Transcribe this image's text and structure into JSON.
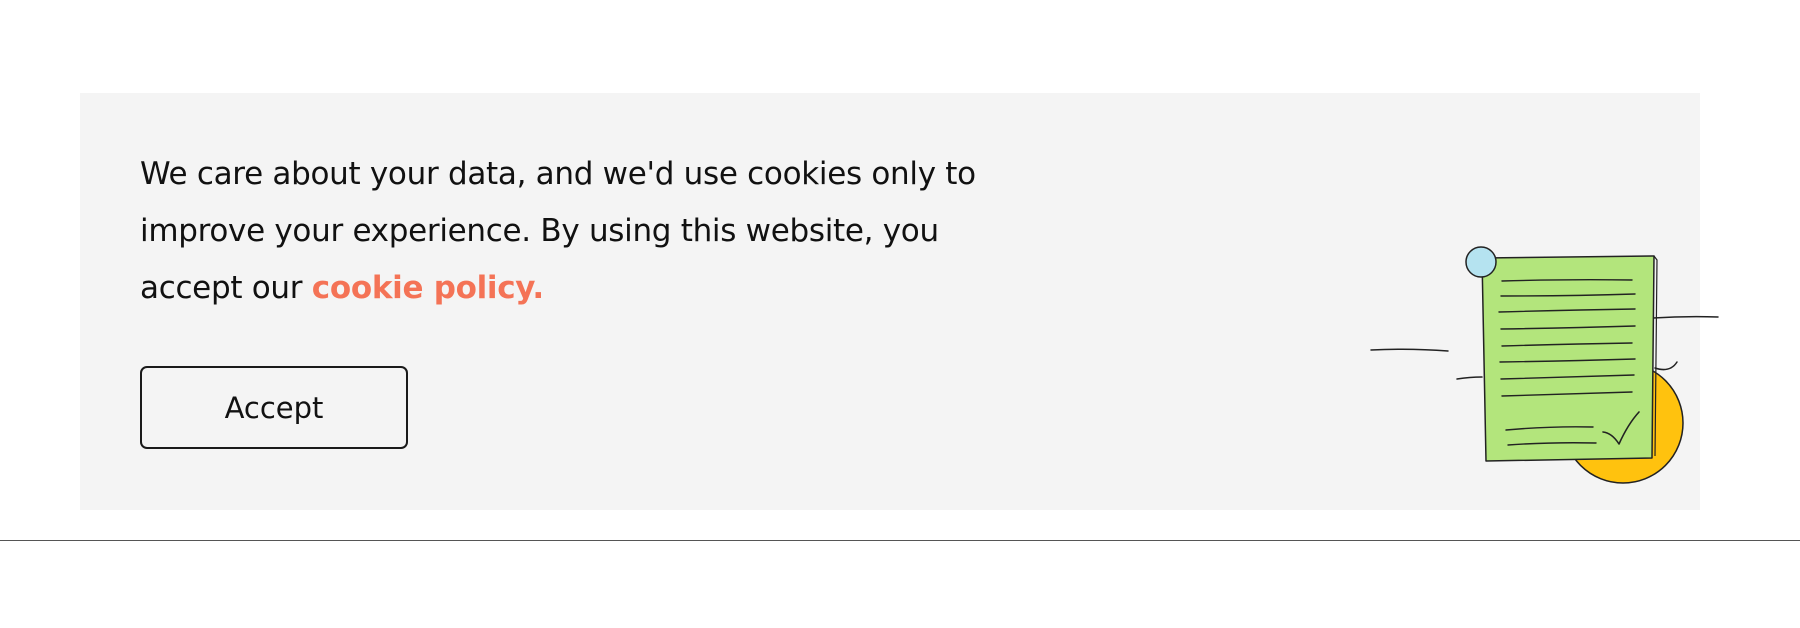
{
  "cookie_banner": {
    "message_text": "We care about your data, and we'd use cookies only to improve your experience. By using this website, you accept our ",
    "policy_link_label": "cookie policy.",
    "accept_button_label": "Accept",
    "illustration_icon": "document-with-checkmark-illustration",
    "colors": {
      "background": "#f4f4f4",
      "link": "#f47356",
      "document": "#b3e57c",
      "pin": "#b5e3f0",
      "circle": "#ffc20e"
    }
  }
}
